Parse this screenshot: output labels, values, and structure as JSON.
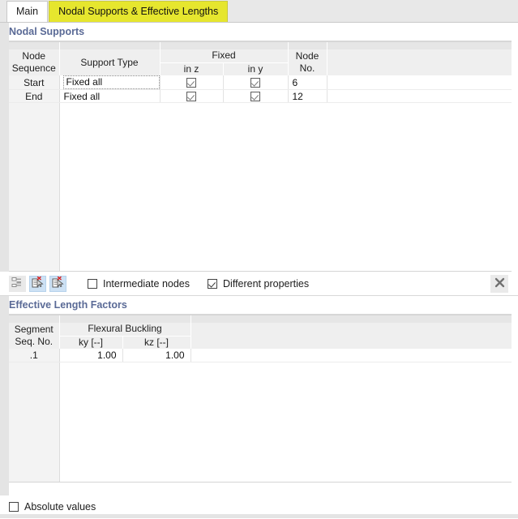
{
  "tabs": [
    {
      "label": "Main",
      "state": "normal"
    },
    {
      "label": "Nodal Supports & Effective Lengths",
      "state": "highlight"
    }
  ],
  "nodal_supports": {
    "section_title": "Nodal Supports",
    "headers": {
      "node_sequence": "Node\nSequence",
      "node_sequence_l1": "Node",
      "node_sequence_l2": "Sequence",
      "support_type": "Support Type",
      "fixed_group": "Fixed",
      "in_z": "in z",
      "in_y": "in y",
      "node_no_l1": "Node",
      "node_no_l2": "No."
    },
    "rows": [
      {
        "sequence": "Start",
        "support_type": "Fixed all",
        "in_z": true,
        "in_y": true,
        "node_no": "6",
        "focused": true
      },
      {
        "sequence": "End",
        "support_type": "Fixed all",
        "in_z": true,
        "in_y": true,
        "node_no": "12",
        "focused": false
      }
    ],
    "toolbar": {
      "buttons": [
        {
          "icon": "indent-list-icon",
          "state": "grayed"
        },
        {
          "icon": "new-document-delete-icon",
          "state": "active"
        },
        {
          "icon": "edit-document-delete-icon",
          "state": "active"
        }
      ],
      "intermediate_nodes": {
        "label": "Intermediate nodes",
        "checked": false
      },
      "different_properties": {
        "label": "Different properties",
        "checked": true
      },
      "close_icon": "close-icon"
    }
  },
  "effective_length_factors": {
    "section_title": "Effective Length Factors",
    "headers": {
      "segment_l1": "Segment",
      "segment_l2": "Seq. No.",
      "flexural_buckling": "Flexural Buckling",
      "ky": "ky [--]",
      "kz": "kz [--]"
    },
    "rows": [
      {
        "segment": ".1",
        "ky": "1.00",
        "kz": "1.00"
      }
    ],
    "absolute_values": {
      "label": "Absolute values",
      "checked": false
    }
  },
  "colors": {
    "tab_highlight": "#e6e62e",
    "section_title": "#5a6a96",
    "header_bg": "#efefef",
    "gutter": "#e4e4e4"
  }
}
